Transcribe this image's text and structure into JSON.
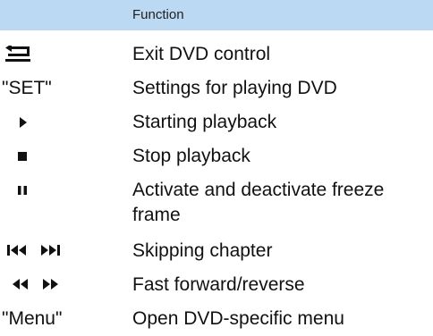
{
  "header": {
    "symbol": "",
    "function": "Function"
  },
  "rows": [
    {
      "symbol_icon": "back-arrow-icon",
      "symbol": "",
      "function": "Exit DVD control"
    },
    {
      "symbol_icon": "",
      "symbol": "\"SET\"",
      "function": "Settings for playing DVD"
    },
    {
      "symbol_icon": "play-icon",
      "symbol": "",
      "function": "Starting playback"
    },
    {
      "symbol_icon": "stop-icon",
      "symbol": "",
      "function": "Stop playback"
    },
    {
      "symbol_icon": "pause-icon",
      "symbol": "",
      "function": "Activate and deactivate freeze frame"
    },
    {
      "symbol_icon": "skip-chapter-icons",
      "symbol": "",
      "function": "Skipping chapter"
    },
    {
      "symbol_icon": "fast-forward-reverse-icons",
      "symbol": "",
      "function": "Fast forward/reverse"
    },
    {
      "symbol_icon": "",
      "symbol": "\"Menu\"",
      "function": "Open DVD-specific menu"
    }
  ]
}
